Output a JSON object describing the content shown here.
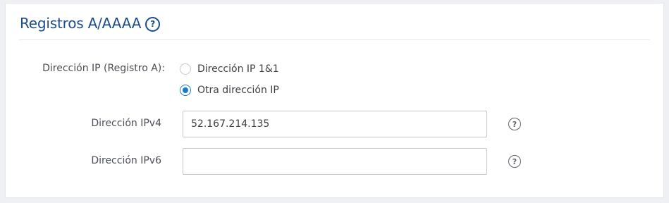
{
  "section": {
    "title": "Registros A/AAAA",
    "help_glyph": "?"
  },
  "ip_a_record": {
    "label": "Dirección IP (Registro A):",
    "options": [
      {
        "label": "Dirección IP 1&1",
        "selected": false
      },
      {
        "label": "Otra dirección IP",
        "selected": true
      }
    ]
  },
  "ipv4": {
    "label": "Dirección IPv4",
    "value": "52.167.214.135",
    "help_glyph": "?"
  },
  "ipv6": {
    "label": "Dirección IPv6",
    "value": "",
    "help_glyph": "?"
  },
  "colors": {
    "accent": "#1a78d6",
    "title": "#1c4b8e",
    "text": "#4a4f55",
    "border": "#c4c8cd",
    "background": "#eef0f3"
  },
  "icons": {
    "title_help": "question-circle-icon",
    "ipv4_help": "question-circle-icon",
    "ipv6_help": "question-circle-icon"
  }
}
